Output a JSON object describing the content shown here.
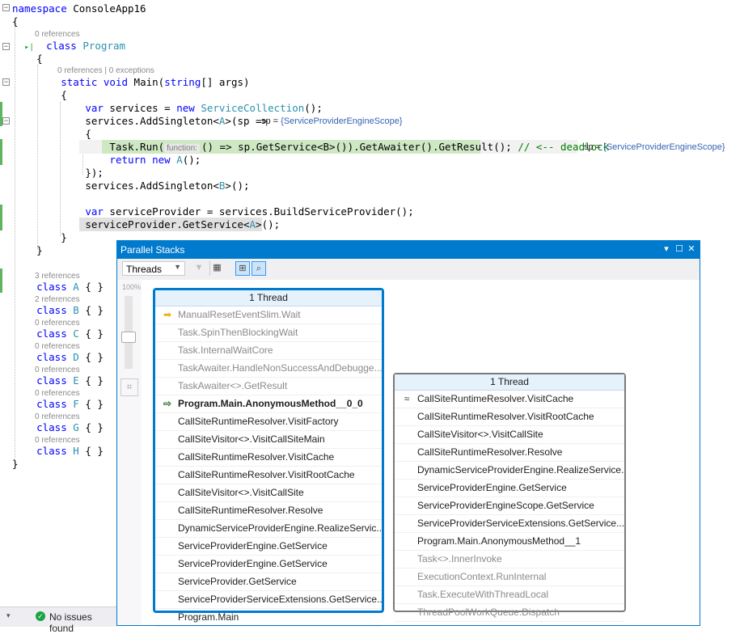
{
  "editor": {
    "line_namespace": "namespace ConsoleApp16",
    "lens_program": "0 references",
    "line_class_program_kw": "class",
    "line_class_program_name": "Program",
    "lens_main": "0 references | 0 exceptions",
    "line_main": {
      "kw1": "static",
      "kw2": "void",
      "name": "Main",
      "open": "(",
      "kw3": "string",
      "rest": "[] args)"
    },
    "line_services": {
      "kw": "var",
      "ident": "services",
      "eq": "=",
      "new": "new",
      "type": "ServiceCollection",
      "tail": "();"
    },
    "line_addsingleton_a": {
      "pre": "services.AddSingleton<",
      "type": "A",
      "post": ">(sp =>"
    },
    "hint_sp1": {
      "name": "sp = ",
      "value": "{ServiceProviderEngineScope}"
    },
    "line_taskrun": {
      "pre": "Task.Run(",
      "inlay": "function:",
      "post": "() => sp.GetService<B>()).GetAwaiter().GetResult();",
      "comment": "// <-- deadlock"
    },
    "hint_sp2": {
      "name": "sp = ",
      "value": "{ServiceProviderEngineScope}"
    },
    "line_return": {
      "kw": "return",
      "new": "new",
      "type": "A",
      "tail": "();"
    },
    "line_close_lambda": "});",
    "line_addsingleton_b": {
      "pre": "services.AddSingleton<",
      "type": "B",
      "post": ">();"
    },
    "line_build": {
      "kw": "var",
      "ident": "serviceProvider",
      "eq": "=",
      "rest": "services.BuildServiceProvider();"
    },
    "line_getservice": {
      "pre": "serviceProvider.GetService<",
      "type": "A",
      "post": ">();"
    },
    "braces": {
      "open": "{",
      "close": "}"
    },
    "classes": [
      {
        "lens": "3 references",
        "name": "A"
      },
      {
        "lens": "2 references",
        "name": "B"
      },
      {
        "lens": "0 references",
        "name": "C"
      },
      {
        "lens": "0 references",
        "name": "D"
      },
      {
        "lens": "0 references",
        "name": "E"
      },
      {
        "lens": "0 references",
        "name": "F"
      },
      {
        "lens": "0 references",
        "name": "G"
      },
      {
        "lens": "0 references",
        "name": "H"
      }
    ],
    "class_kw": "class",
    "class_body": "{ }"
  },
  "status": {
    "text": "No issues found",
    "icon": "check-circle-icon"
  },
  "panel": {
    "title": "Parallel Stacks",
    "threads_select": "Threads",
    "zoom_label": "100%",
    "node_left": {
      "header": "1 Thread",
      "frames": [
        {
          "text": "ManualResetEventSlim.Wait",
          "style": "ext",
          "icon": "current-frame-arrow-icon"
        },
        {
          "text": "Task.SpinThenBlockingWait",
          "style": "ext"
        },
        {
          "text": "Task.InternalWaitCore",
          "style": "ext"
        },
        {
          "text": "TaskAwaiter.HandleNonSuccessAndDebugge...",
          "style": "ext"
        },
        {
          "text": "TaskAwaiter<>.GetResult",
          "style": "ext"
        },
        {
          "text": "Program.Main.AnonymousMethod__0_0",
          "style": "bold",
          "icon": "return-arrow-icon"
        },
        {
          "text": "CallSiteRuntimeResolver.VisitFactory",
          "style": "normal"
        },
        {
          "text": "CallSiteVisitor<>.VisitCallSiteMain",
          "style": "normal"
        },
        {
          "text": "CallSiteRuntimeResolver.VisitCache",
          "style": "normal"
        },
        {
          "text": "CallSiteRuntimeResolver.VisitRootCache",
          "style": "normal"
        },
        {
          "text": "CallSiteVisitor<>.VisitCallSite",
          "style": "normal"
        },
        {
          "text": "CallSiteRuntimeResolver.Resolve",
          "style": "normal"
        },
        {
          "text": "DynamicServiceProviderEngine.RealizeServic...",
          "style": "normal"
        },
        {
          "text": "ServiceProviderEngine.GetService",
          "style": "normal"
        },
        {
          "text": "ServiceProviderEngine.GetService",
          "style": "normal"
        },
        {
          "text": "ServiceProvider.GetService",
          "style": "normal"
        },
        {
          "text": "ServiceProviderServiceExtensions.GetService...",
          "style": "normal"
        },
        {
          "text": "Program.Main",
          "style": "normal"
        }
      ]
    },
    "node_right": {
      "header": "1 Thread",
      "frames": [
        {
          "text": "CallSiteRuntimeResolver.VisitCache",
          "style": "normal",
          "icon": "threads-icon"
        },
        {
          "text": "CallSiteRuntimeResolver.VisitRootCache",
          "style": "normal"
        },
        {
          "text": "CallSiteVisitor<>.VisitCallSite",
          "style": "normal"
        },
        {
          "text": "CallSiteRuntimeResolver.Resolve",
          "style": "normal"
        },
        {
          "text": "DynamicServiceProviderEngine.RealizeService...",
          "style": "normal"
        },
        {
          "text": "ServiceProviderEngine.GetService",
          "style": "normal"
        },
        {
          "text": "ServiceProviderEngineScope.GetService",
          "style": "normal"
        },
        {
          "text": "ServiceProviderServiceExtensions.GetService...",
          "style": "normal"
        },
        {
          "text": "Program.Main.AnonymousMethod__1",
          "style": "normal"
        },
        {
          "text": "Task<>.InnerInvoke",
          "style": "ext"
        },
        {
          "text": "ExecutionContext.RunInternal",
          "style": "ext"
        },
        {
          "text": "Task.ExecuteWithThreadLocal",
          "style": "ext"
        },
        {
          "text": "ThreadPoolWorkQueue.Dispatch",
          "style": "ext"
        }
      ]
    }
  },
  "colors": {
    "accent": "#007acc",
    "keyword": "#0000ff",
    "type": "#2b91af",
    "comment": "#008000",
    "highlight": "#cfe8c4"
  }
}
